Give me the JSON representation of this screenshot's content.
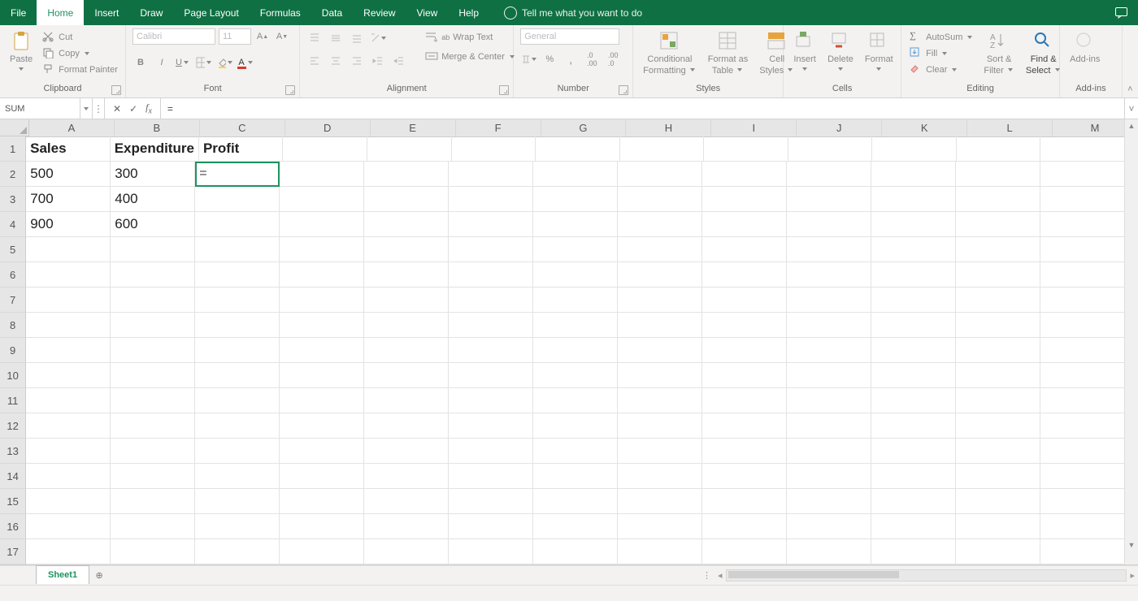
{
  "tabs": {
    "file": "File",
    "home": "Home",
    "insert": "Insert",
    "draw": "Draw",
    "page_layout": "Page Layout",
    "formulas": "Formulas",
    "data": "Data",
    "review": "Review",
    "view": "View",
    "help": "Help"
  },
  "tellme": "Tell me what you want to do",
  "ribbon": {
    "clipboard": {
      "label": "Clipboard",
      "paste": "Paste",
      "cut": "Cut",
      "copy": "Copy",
      "format_painter": "Format Painter"
    },
    "font": {
      "label": "Font",
      "name": "Calibri",
      "size": "11"
    },
    "alignment": {
      "label": "Alignment",
      "wrap": "Wrap Text",
      "merge": "Merge & Center"
    },
    "number": {
      "label": "Number",
      "format": "General",
      "percent": "%",
      "comma": ","
    },
    "styles": {
      "label": "Styles",
      "cond": "Conditional",
      "cond2": "Formatting",
      "fat": "Format as",
      "fat2": "Table",
      "cell": "Cell",
      "cell2": "Styles"
    },
    "cells": {
      "label": "Cells",
      "insert": "Insert",
      "delete": "Delete",
      "format": "Format"
    },
    "editing": {
      "label": "Editing",
      "autosum": "AutoSum",
      "fill": "Fill",
      "clear": "Clear",
      "sort": "Sort &",
      "sort2": "Filter",
      "find": "Find &",
      "find2": "Select"
    },
    "addins": {
      "label": "Add-ins",
      "addins": "Add-ins"
    }
  },
  "namebox": "SUM",
  "formula": "=",
  "columns": [
    "A",
    "B",
    "C",
    "D",
    "E",
    "F",
    "G",
    "H",
    "I",
    "J",
    "K",
    "L",
    "M"
  ],
  "row_count": 18,
  "cells": {
    "A1": "Sales",
    "B1": "Expenditure",
    "C1": "Profit",
    "A2": "500",
    "B2": "300",
    "C2": "=",
    "A3": "700",
    "B3": "400",
    "A4": "900",
    "B4": "600"
  },
  "active_cell": "C2",
  "sheet": "Sheet1"
}
